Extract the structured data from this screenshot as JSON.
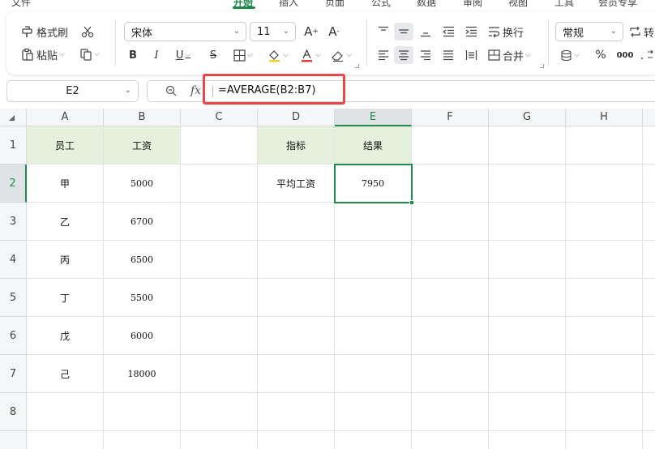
{
  "menu": {
    "items": [
      "文件",
      "开始",
      "插入",
      "页面",
      "公式",
      "数据",
      "审阅",
      "视图",
      "工具",
      "会员专享"
    ],
    "active": "开始"
  },
  "ribbon": {
    "format_painter": "格式刷",
    "paste": "粘贴",
    "font_name": "宋体",
    "font_size": "11",
    "wrap": "换行",
    "merge": "合并",
    "number_format": "常规",
    "convert": "转",
    "bold": "B",
    "italic": "I",
    "underline": "U",
    "strike": "S",
    "grow_font": "A",
    "shrink_font": "A",
    "percent": "%",
    "thousands": "000"
  },
  "formula_bar": {
    "name_box": "E2",
    "fx_label": "fx",
    "formula": "=AVERAGE(B2:B7)"
  },
  "sheet": {
    "columns": [
      "A",
      "B",
      "C",
      "D",
      "E",
      "F",
      "G",
      "H"
    ],
    "rows": [
      "1",
      "2",
      "3",
      "4",
      "5",
      "6",
      "7",
      "8"
    ],
    "active_cell": "E2",
    "cells": {
      "A1": "员工",
      "B1": "工资",
      "A2": "甲",
      "B2": "5000",
      "A3": "乙",
      "B3": "6700",
      "A4": "丙",
      "B4": "6500",
      "A5": "丁",
      "B5": "5500",
      "A6": "戊",
      "B6": "6000",
      "A7": "己",
      "B7": "18000",
      "D1": "指标",
      "E1": "结果",
      "D2": "平均工资",
      "E2": "7950"
    }
  },
  "colors": {
    "accent": "#1f8a4c",
    "header_fill": "#e5f1dc",
    "highlight": "#e8474a"
  }
}
